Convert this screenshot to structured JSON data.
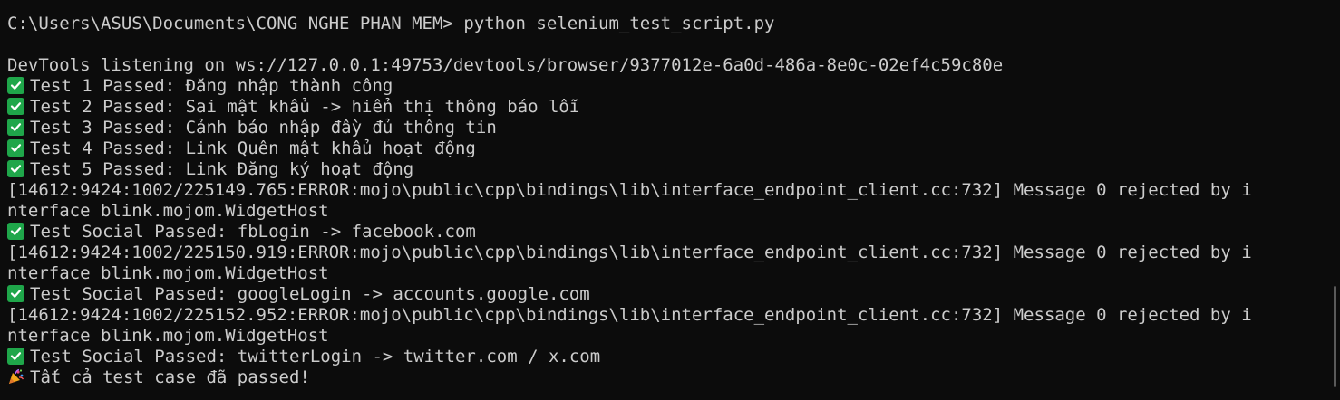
{
  "terminal": {
    "lines": {
      "l0": "C:\\Users\\ASUS\\Documents\\CONG NGHE PHAN MEM> python selenium_test_script.py",
      "l1": "",
      "l2": "DevTools listening on ws://127.0.0.1:49753/devtools/browser/9377012e-6a0d-486a-8e0c-02ef4c59c80e",
      "l3": "Test 1 Passed: Đăng nhập thành công",
      "l4": "Test 2 Passed: Sai mật khẩu -> hiển thị thông báo lỗi",
      "l5": "Test 3 Passed: Cảnh báo nhập đầy đủ thông tin",
      "l6": "Test 4 Passed: Link Quên mật khẩu hoạt động",
      "l7": "Test 5 Passed: Link Đăng ký hoạt động",
      "l8": "[14612:9424:1002/225149.765:ERROR:mojo\\public\\cpp\\bindings\\lib\\interface_endpoint_client.cc:732] Message 0 rejected by i",
      "l9": "nterface blink.mojom.WidgetHost",
      "l10": "Test Social Passed: fbLogin -> facebook.com",
      "l11": "[14612:9424:1002/225150.919:ERROR:mojo\\public\\cpp\\bindings\\lib\\interface_endpoint_client.cc:732] Message 0 rejected by i",
      "l12": "nterface blink.mojom.WidgetHost",
      "l13": "Test Social Passed: googleLogin -> accounts.google.com",
      "l14": "[14612:9424:1002/225152.952:ERROR:mojo\\public\\cpp\\bindings\\lib\\interface_endpoint_client.cc:732] Message 0 rejected by i",
      "l15": "nterface blink.mojom.WidgetHost",
      "l16": "Test Social Passed: twitterLogin -> twitter.com / x.com",
      "l17": "Tất cả test case đã passed!"
    },
    "icons": {
      "pass": "check-mark-button-icon",
      "done": "party-popper-icon"
    },
    "colors": {
      "background": "#0c0c0c",
      "text": "#cccccc",
      "check_green": "#1fa64a"
    }
  }
}
